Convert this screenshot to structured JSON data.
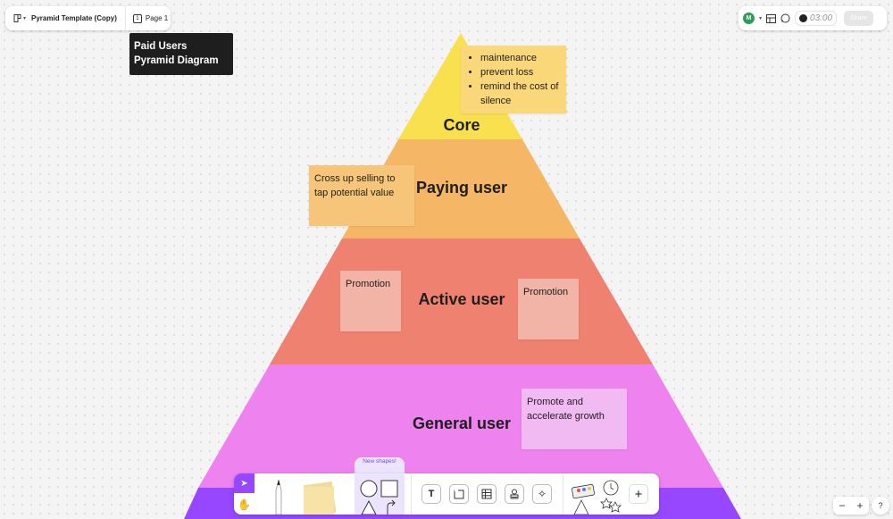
{
  "file": {
    "name": "Pyramid Template (Copy)",
    "page_label": "Page 1"
  },
  "header_right": {
    "avatar_initial": "M",
    "timer": "03:00",
    "share_label": "Share"
  },
  "board": {
    "title": "Paid Users Pyramid Diagram",
    "tiers": [
      {
        "label": "Core",
        "color": "#f9e04f"
      },
      {
        "label": "Paying user",
        "color": "#f5b766"
      },
      {
        "label": "Active user",
        "color": "#ee8170"
      },
      {
        "label": "General user",
        "color": "#ee82ee"
      },
      {
        "label": "",
        "color": "#9747ff"
      }
    ],
    "stickies": {
      "core_notes": {
        "items": [
          "maintenance",
          "prevent loss",
          "remind the cost of silence"
        ],
        "color": "#fad779"
      },
      "paying_note": {
        "text": "Cross up selling to tap potential value",
        "color": "#f7c57a"
      },
      "active_note_left": {
        "text": "Promotion",
        "color": "#f1b4a6"
      },
      "active_note_right": {
        "text": "Promotion",
        "color": "#f1b4a6"
      },
      "general_note": {
        "text": "Promote and accelerate growth",
        "color": "#f2baf2"
      }
    }
  },
  "toolbar": {
    "new_shapes_label": "New shapes!",
    "tools": [
      {
        "name": "move-tool",
        "icon": "cursor-icon"
      },
      {
        "name": "hand-tool",
        "icon": "hand-icon"
      },
      {
        "name": "marker-tool",
        "icon": "marker-icon"
      },
      {
        "name": "sticky-tool",
        "icon": "sticky-note-icon"
      },
      {
        "name": "shapes-tool",
        "icon": "shapes-icon"
      },
      {
        "name": "text-tool",
        "icon": "text-icon"
      },
      {
        "name": "section-tool",
        "icon": "section-icon"
      },
      {
        "name": "table-tool",
        "icon": "table-icon"
      },
      {
        "name": "stamp-tool",
        "icon": "stamp-icon"
      },
      {
        "name": "ai-tool",
        "icon": "sparkle-icon"
      },
      {
        "name": "widgets-tool",
        "icon": "widgets-icon"
      },
      {
        "name": "more-tool",
        "icon": "plus-icon"
      }
    ],
    "accent_color": "#9747ff"
  },
  "zoom_controls": {
    "minus": "−",
    "plus": "+",
    "help": "?"
  }
}
